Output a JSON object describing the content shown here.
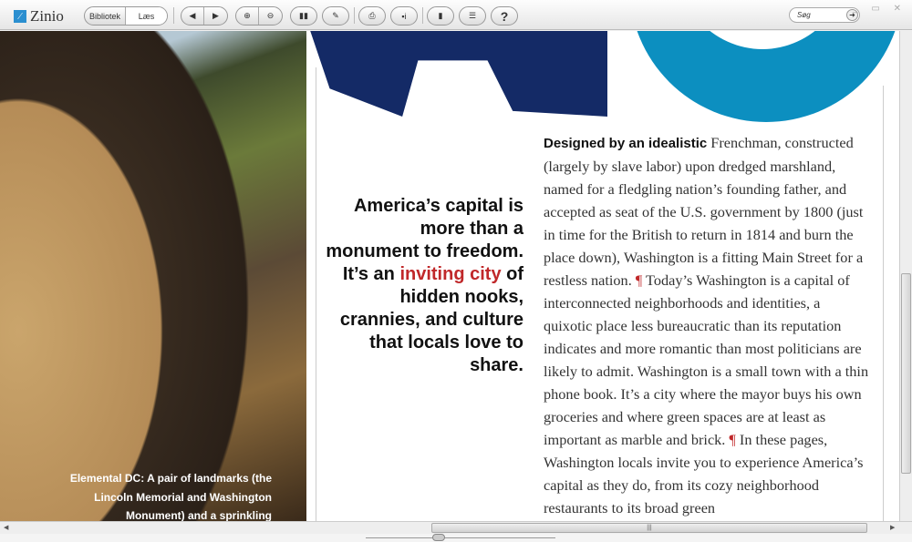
{
  "app": {
    "name": "Zinio"
  },
  "toolbar": {
    "library": "Bibliotek",
    "read": "Læs",
    "search_placeholder": "Søg"
  },
  "icons": [
    "back-icon",
    "forward-icon",
    "zoom-in-icon",
    "zoom-out-icon",
    "book-icon",
    "pen-icon",
    "print-icon",
    "share-icon",
    "bookshelf-icon",
    "toc-icon",
    "help-icon"
  ],
  "article": {
    "pull_quote": {
      "before": "America’s capital is more than a monument to freedom. It’s an ",
      "highlight": "inviting city",
      "after": " of hidden nooks, crannies, and culture that locals love to share."
    },
    "lead": "Designed by an idealistic",
    "body1": " Frenchman, constructed (largely by slave labor) upon dredged marshland, named for a fledgling nation’s founding father, and accepted as seat of the U.S. government by 1800 (just in time for the British to return in 1814 and burn the place down), Washington is a fitting Main Street for a restless nation. ",
    "body2": " Today’s Washington is a capital of interconnected neighborhoods and identities, a quixotic place less bureaucratic than its reputation indicates and more romantic than most politicians are likely to admit. Washington is a small town with a thin phone book. It’s a city where the mayor buys his own groceries and where green spaces are at least as important as marble and brick. ",
    "body3": " In these pages, Washington locals invite you to experience America’s capital as they do, from its cozy neighborhood restaurants to its broad green",
    "pilcrow": "¶",
    "caption": "Elemental DC: A pair of landmarks (the Lincoln Memorial and Washington Monument) and a sprinkling"
  }
}
